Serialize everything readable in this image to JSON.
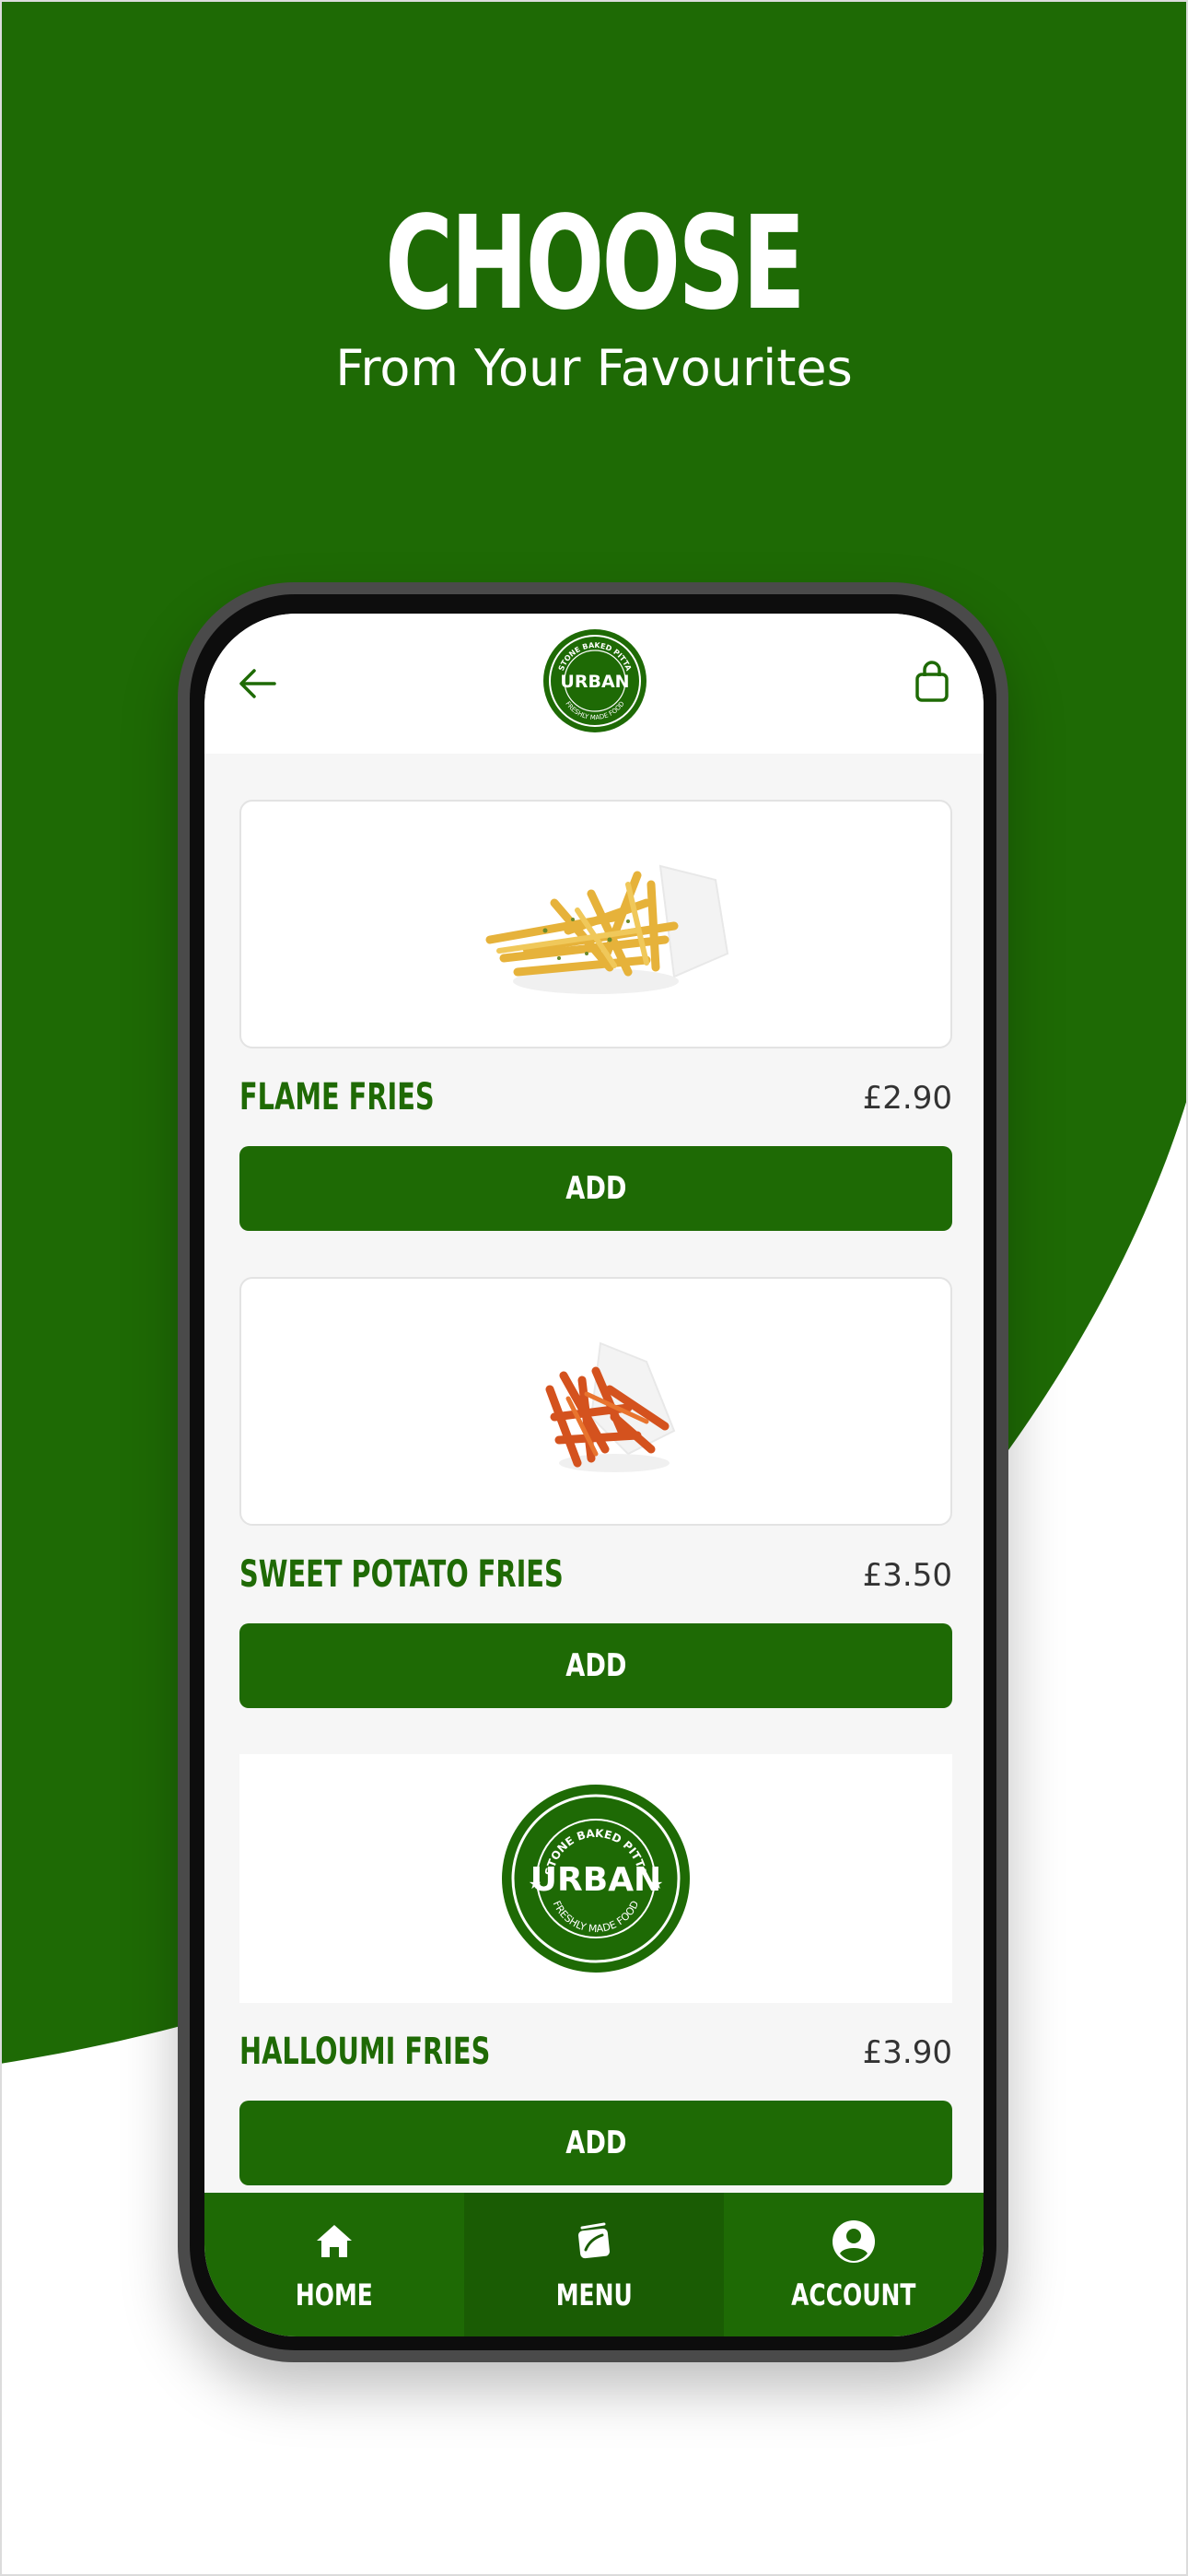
{
  "hero": {
    "title": "CHOOSE",
    "subtitle": "From Your Favourites"
  },
  "header": {
    "back_icon": "arrow-left-icon",
    "logo": {
      "top_text": "STONE BAKED PITTA",
      "brand": "URBAN",
      "bottom_text": "FRESHLY MADE FOOD"
    },
    "bag_icon": "shopping-bag-icon"
  },
  "menu_items": [
    {
      "name": "FLAME FRIES",
      "price": "£2.90",
      "add_label": "ADD",
      "image": "fries-image"
    },
    {
      "name": "SWEET POTATO FRIES",
      "price": "£3.50",
      "add_label": "ADD",
      "image": "sweet-potato-fries-image"
    },
    {
      "name": "HALLOUMI FRIES",
      "price": "£3.90",
      "add_label": "ADD",
      "image": "urban-logo-placeholder"
    }
  ],
  "bottom_nav": [
    {
      "label": "HOME",
      "icon": "home-icon",
      "active": false
    },
    {
      "label": "MENU",
      "icon": "menu-book-icon",
      "active": true
    },
    {
      "label": "ACCOUNT",
      "icon": "account-circle-icon",
      "active": false
    }
  ],
  "colors": {
    "brand_green": "#1e6a05",
    "background": "#ffffff",
    "screen_bg": "#f6f6f6"
  }
}
